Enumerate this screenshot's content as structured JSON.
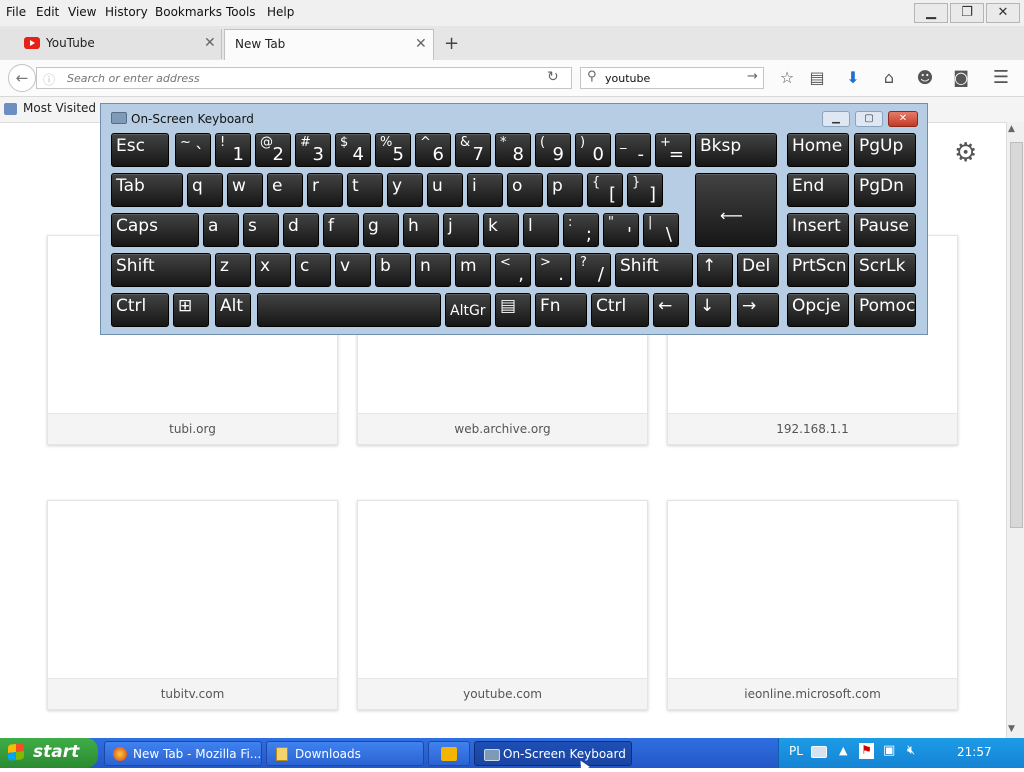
{
  "menubar": {
    "items": [
      "File",
      "Edit",
      "View",
      "History",
      "Bookmarks",
      "Tools",
      "Help"
    ]
  },
  "tabs": [
    {
      "label": "YouTube"
    },
    {
      "label": "New Tab"
    }
  ],
  "navbar": {
    "url_placeholder": "Search or enter address",
    "search_value": "youtube"
  },
  "bookmarks": {
    "most_visited": "Most Visited"
  },
  "tiles": [
    {
      "caption": "tubi.org"
    },
    {
      "caption": "web.archive.org"
    },
    {
      "caption": "192.168.1.1"
    },
    {
      "caption": "tubitv.com"
    },
    {
      "caption": "youtube.com"
    },
    {
      "caption": "ieonline.microsoft.com"
    }
  ],
  "osk": {
    "title": "On-Screen Keyboard",
    "rows": [
      [
        {
          "l": "Esc"
        },
        {
          "s": "~",
          "m": "`"
        },
        {
          "s": "!",
          "m": "1"
        },
        {
          "s": "@",
          "m": "2"
        },
        {
          "s": "#",
          "m": "3"
        },
        {
          "s": "$",
          "m": "4"
        },
        {
          "s": "%",
          "m": "5"
        },
        {
          "s": "^",
          "m": "6"
        },
        {
          "s": "&",
          "m": "7"
        },
        {
          "s": "*",
          "m": "8"
        },
        {
          "s": "(",
          "m": "9"
        },
        {
          "s": ")",
          "m": "0"
        },
        {
          "s": "_",
          "m": "-"
        },
        {
          "s": "+",
          "m": "="
        },
        {
          "l": "Bksp"
        },
        {
          "l": "Home"
        },
        {
          "l": "PgUp"
        }
      ],
      [
        {
          "l": "Tab"
        },
        {
          "l": "q"
        },
        {
          "l": "w"
        },
        {
          "l": "e"
        },
        {
          "l": "r"
        },
        {
          "l": "t"
        },
        {
          "l": "y"
        },
        {
          "l": "u"
        },
        {
          "l": "i"
        },
        {
          "l": "o"
        },
        {
          "l": "p"
        },
        {
          "s": "{",
          "m": "["
        },
        {
          "s": "}",
          "m": "]"
        },
        {
          "l": ""
        },
        {
          "l": "End"
        },
        {
          "l": "PgDn"
        }
      ],
      [
        {
          "l": "Caps"
        },
        {
          "l": "a"
        },
        {
          "l": "s"
        },
        {
          "l": "d"
        },
        {
          "l": "f"
        },
        {
          "l": "g"
        },
        {
          "l": "h"
        },
        {
          "l": "j"
        },
        {
          "l": "k"
        },
        {
          "l": "l"
        },
        {
          "s": ":",
          "m": ";"
        },
        {
          "s": "\"",
          "m": "'"
        },
        {
          "s": "|",
          "m": "\\"
        },
        {
          "l": "⟵"
        },
        {
          "l": "Insert"
        },
        {
          "l": "Pause"
        }
      ],
      [
        {
          "l": "Shift"
        },
        {
          "l": "z"
        },
        {
          "l": "x"
        },
        {
          "l": "c"
        },
        {
          "l": "v"
        },
        {
          "l": "b"
        },
        {
          "l": "n"
        },
        {
          "l": "m"
        },
        {
          "s": "<",
          "m": ","
        },
        {
          "s": ">",
          "m": "."
        },
        {
          "s": "?",
          "m": "/"
        },
        {
          "l": "Shift"
        },
        {
          "l": "↑"
        },
        {
          "l": "Del"
        },
        {
          "l": "PrtScn"
        },
        {
          "l": "ScrLk"
        }
      ],
      [
        {
          "l": "Ctrl"
        },
        {
          "l": "⊞"
        },
        {
          "l": "Alt"
        },
        {
          "l": ""
        },
        {
          "l": "AltGr"
        },
        {
          "l": "▤"
        },
        {
          "l": "Fn"
        },
        {
          "l": "Ctrl"
        },
        {
          "l": "←"
        },
        {
          "l": "↓"
        },
        {
          "l": "→"
        },
        {
          "l": "Opcje"
        },
        {
          "l": "Pomoc"
        }
      ]
    ]
  },
  "taskbar": {
    "start": "start",
    "tasks": [
      {
        "label": "New Tab - Mozilla Fi..."
      },
      {
        "label": "Downloads"
      },
      {
        "label": ""
      },
      {
        "label": "On-Screen Keyboard"
      }
    ],
    "lang": "PL",
    "clock": "21:57"
  },
  "colors": {
    "taskbar": "#2457c8",
    "start": "#2b8a31",
    "osk_frame": "#b7cde4",
    "key": "#1f1f1f",
    "youtube_red": "#e62117",
    "download_blue": "#1d6fd6"
  }
}
